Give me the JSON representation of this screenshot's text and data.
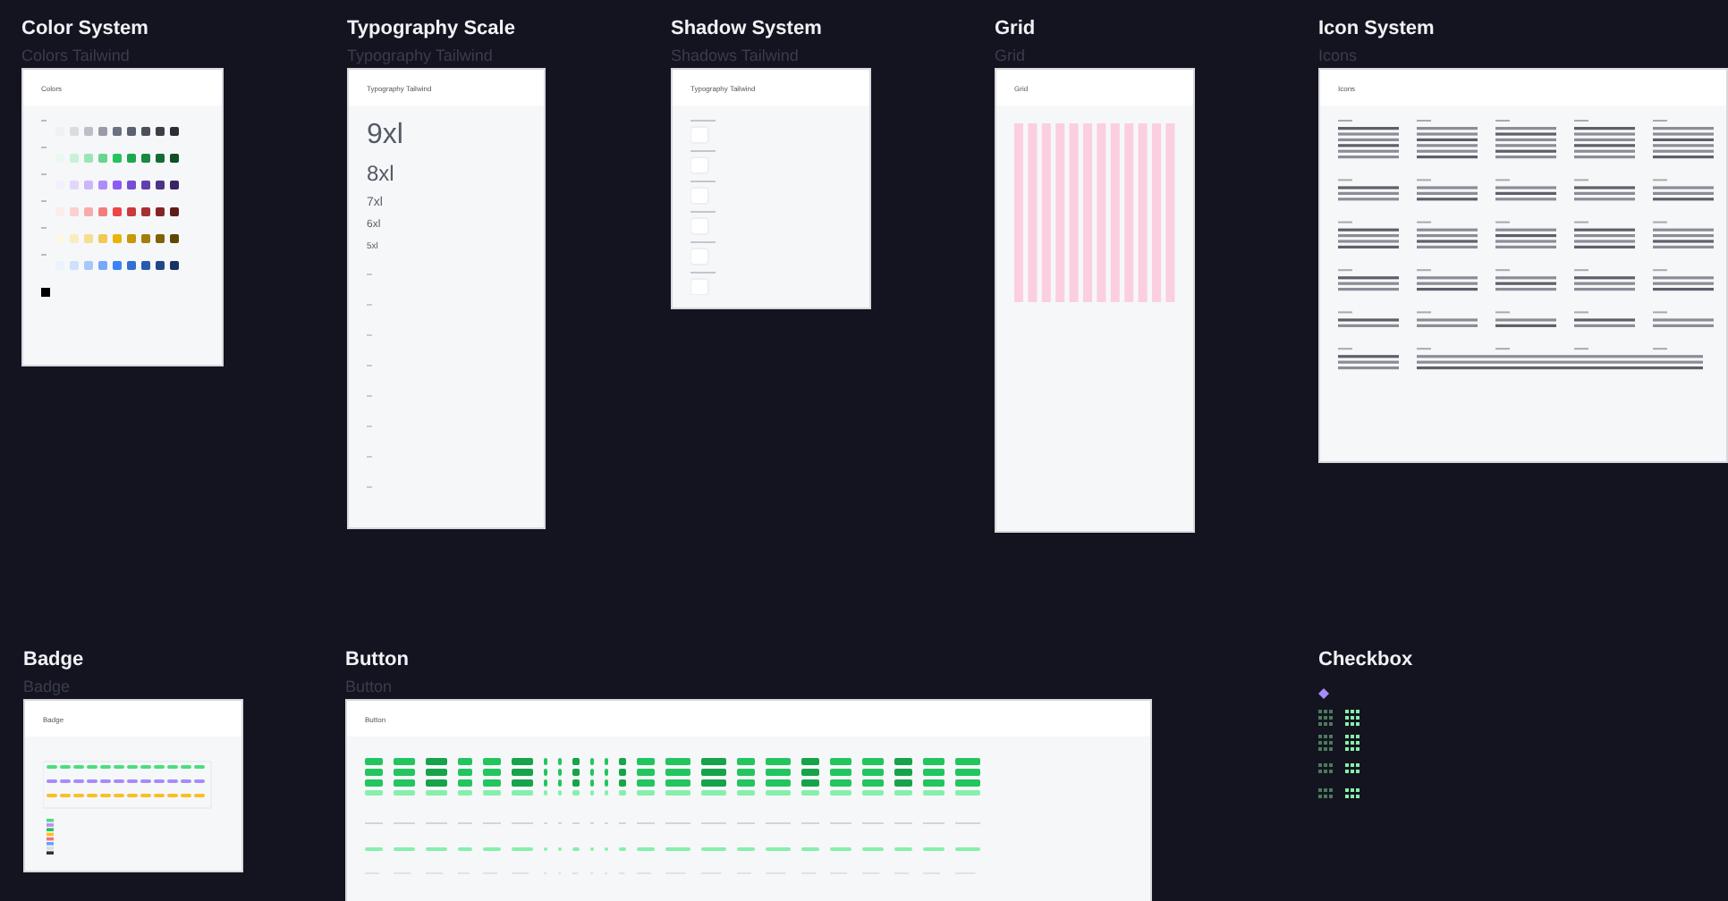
{
  "sections": [
    {
      "kind": "colors",
      "title": "Color System",
      "subtitle": "Colors Tailwind",
      "frame_label": "Colors",
      "palettes": [
        {
          "color": "#6b7280"
        },
        {
          "color": "#22c55e"
        },
        {
          "color": "#8b5cf6"
        },
        {
          "color": "#ef4444"
        },
        {
          "color": "#eab308"
        },
        {
          "color": "#3b82f6"
        }
      ]
    },
    {
      "kind": "typography",
      "title": "Typography Scale",
      "subtitle": "Typography Tailwind",
      "frame_label": "Typography Tailwind",
      "samples": [
        "9xl",
        "8xl",
        "7xl",
        "6xl",
        "5xl"
      ]
    },
    {
      "kind": "shadows",
      "title": "Shadow System",
      "subtitle": "Shadows Tailwind",
      "frame_label": "Typography Tailwind"
    },
    {
      "kind": "grid",
      "title": "Grid",
      "subtitle": "Grid",
      "frame_label": "Grid"
    },
    {
      "kind": "icons",
      "title": "Icon System",
      "subtitle": "Icons",
      "frame_label": "Icons"
    },
    {
      "kind": "badge",
      "title": "Badge",
      "subtitle": "Badge",
      "frame_label": "Badge"
    },
    {
      "kind": "button",
      "title": "Button",
      "subtitle": "Button",
      "frame_label": "Button"
    },
    {
      "kind": "checkbox",
      "title": "Checkbox"
    }
  ]
}
